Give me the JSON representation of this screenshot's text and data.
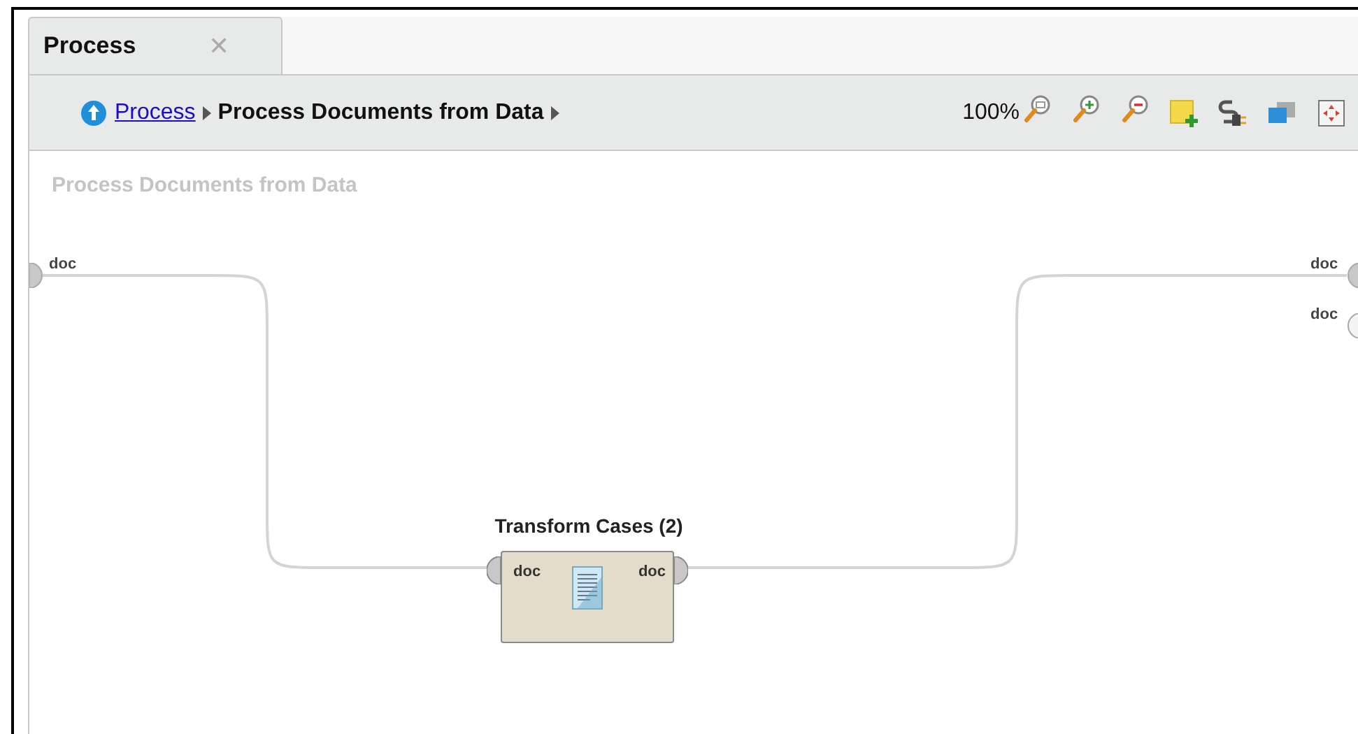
{
  "tab": {
    "label": "Process",
    "close": "✕",
    "selected": true
  },
  "breadcrumb": {
    "link": "Process",
    "current": "Process Documents from Data"
  },
  "toolbar": {
    "zoom": "100%",
    "tools": [
      {
        "kind": "zoomreset"
      },
      {
        "kind": "zoomin"
      },
      {
        "kind": "zoomout"
      },
      {
        "kind": "note"
      },
      {
        "kind": "connect"
      },
      {
        "kind": "layers"
      },
      {
        "kind": "fit"
      }
    ]
  },
  "canvas": {
    "title": "Process Documents from Data",
    "input_ports": [
      {
        "label": "doc",
        "connected": true
      }
    ],
    "output_ports": [
      {
        "label": "doc",
        "connected": true
      },
      {
        "label": "doc",
        "connected": false
      }
    ],
    "operators": [
      {
        "name": "Transform Cases (2)",
        "in_port": "doc",
        "out_port": "doc"
      }
    ]
  }
}
